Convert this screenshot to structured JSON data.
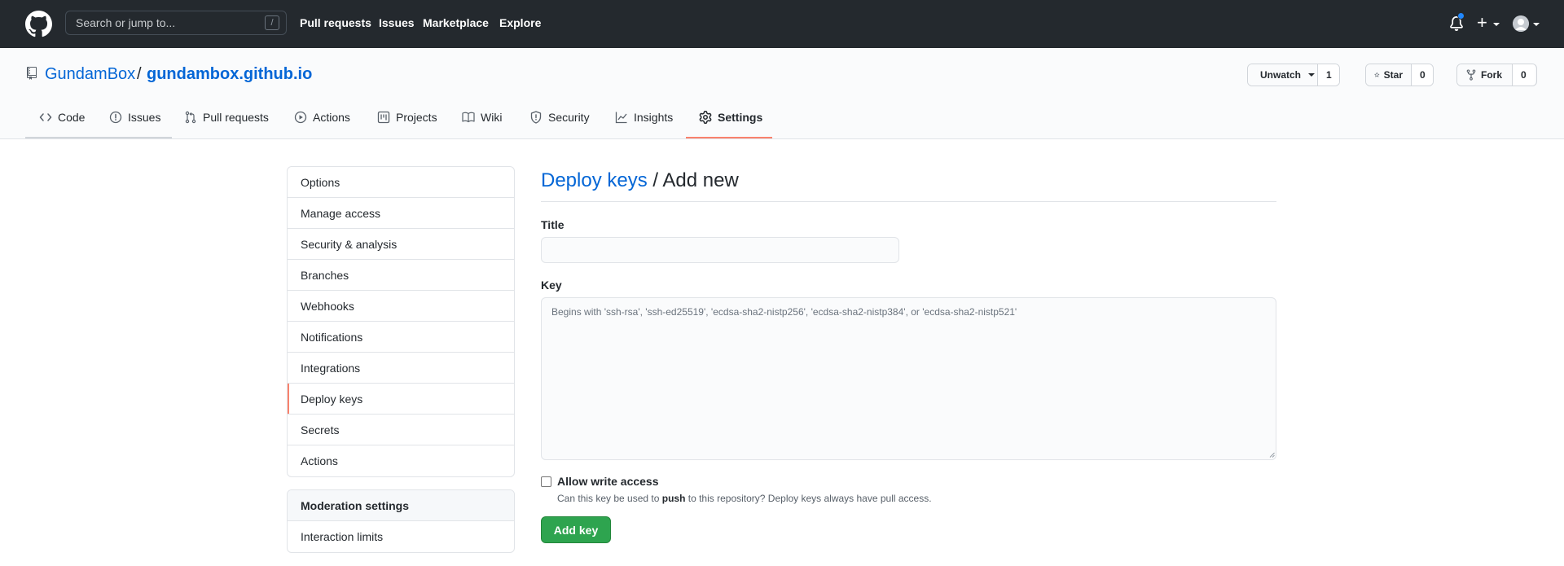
{
  "header": {
    "search_placeholder": "Search or jump to...",
    "search_shortcut": "/",
    "nav": [
      "Pull requests",
      "Issues",
      "Marketplace",
      "Explore"
    ],
    "plus": "+"
  },
  "repo": {
    "owner": "GundamBox",
    "separator": "/",
    "name": "gundambox.github.io",
    "watch_label": "Unwatch",
    "watch_count": "1",
    "star_label": "Star",
    "star_count": "0",
    "fork_label": "Fork",
    "fork_count": "0"
  },
  "tabs": [
    {
      "label": "Code",
      "icon": "code-icon"
    },
    {
      "label": "Issues",
      "icon": "issue-icon"
    },
    {
      "label": "Pull requests",
      "icon": "pull-request-icon"
    },
    {
      "label": "Actions",
      "icon": "play-icon"
    },
    {
      "label": "Projects",
      "icon": "project-icon"
    },
    {
      "label": "Wiki",
      "icon": "book-icon"
    },
    {
      "label": "Security",
      "icon": "shield-icon"
    },
    {
      "label": "Insights",
      "icon": "graph-icon"
    },
    {
      "label": "Settings",
      "icon": "gear-icon",
      "selected": true
    }
  ],
  "sidebar": {
    "items": [
      "Options",
      "Manage access",
      "Security & analysis",
      "Branches",
      "Webhooks",
      "Notifications",
      "Integrations",
      "Deploy keys",
      "Secrets",
      "Actions"
    ],
    "active": "Deploy keys",
    "moderation_heading": "Moderation settings",
    "moderation_items": [
      "Interaction limits"
    ]
  },
  "main": {
    "title_link": "Deploy keys",
    "title_rest": " / Add new",
    "title_label": "Title",
    "title_value": "",
    "key_label": "Key",
    "key_placeholder": "Begins with 'ssh-rsa', 'ssh-ed25519', 'ecdsa-sha2-nistp256', 'ecdsa-sha2-nistp384', or 'ecdsa-sha2-nistp521'",
    "write_access_label": "Allow write access",
    "write_access_checked": false,
    "write_access_note_pre": "Can this key be used to ",
    "write_access_note_bold": "push",
    "write_access_note_post": " to this repository? Deploy keys always have pull access.",
    "submit_label": "Add key"
  },
  "colors": {
    "header_bg": "#24292e",
    "link": "#0366d6",
    "active_accent": "#f9826c",
    "primary_button": "#2ea44f",
    "notification_dot": "#2188ff"
  }
}
